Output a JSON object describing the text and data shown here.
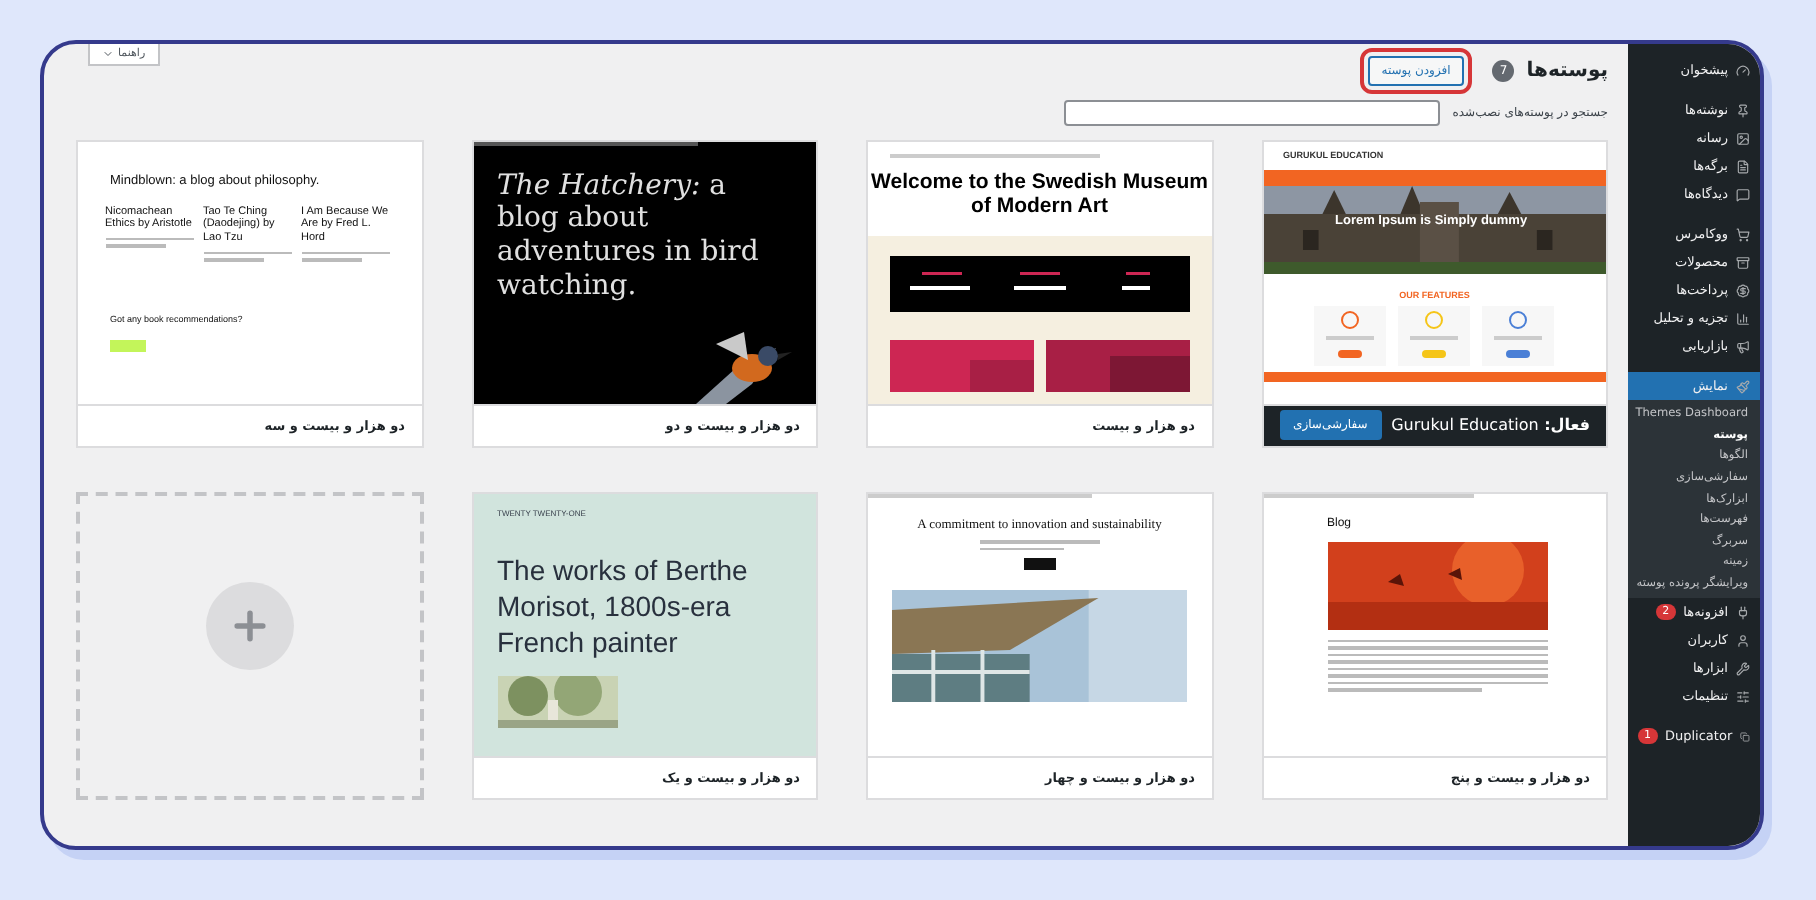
{
  "help_tab": {
    "label": "راهنما"
  },
  "header": {
    "title": "پوسته‌ها",
    "count": "7",
    "add_button": "افزودن پوسته"
  },
  "search": {
    "label": "جستجو در پوسته‌های نصب‌شده"
  },
  "themes": [
    {
      "kind": "gurukul",
      "active": true,
      "active_prefix": "فعال:",
      "name": "Gurukul Education",
      "customize_button": "سفارشی‌سازی",
      "preview": {
        "logo": "GURUKUL EDUCATION",
        "hero": "Lorem Ipsum is Simply dummy",
        "features": "OUR FEATURES"
      }
    },
    {
      "kind": "museum",
      "active": false,
      "name": "دو هزار و بیست",
      "preview": {
        "headline": "Welcome to the Swedish Museum of Modern Art"
      }
    },
    {
      "kind": "hatchery",
      "active": false,
      "name": "دو هزار و بیست و دو",
      "preview": {
        "headline": "*The Hatchery:* a blog about adventures in bird watching."
      }
    },
    {
      "kind": "mindblown",
      "active": false,
      "name": "دو هزار و بیست و سه",
      "preview": {
        "headline": "Mindblown: a blog about philosophy.",
        "posts": [
          "I Am Because We Are by Fred L. Hord",
          "Tao Te Ching (Daodejing) by Lao Tzu",
          "Nicomachean Ethics by Aristotle"
        ],
        "question": "Got any book recommendations?"
      }
    },
    {
      "kind": "blog",
      "active": false,
      "name": "دو هزار و بیست و پنج",
      "preview": {
        "headline": "Blog"
      }
    },
    {
      "kind": "commitment",
      "active": false,
      "name": "دو هزار و بیست و چهار",
      "preview": {
        "headline": "A commitment to innovation and sustainability"
      }
    },
    {
      "kind": "painter",
      "active": false,
      "name": "دو هزار و بیست و یک",
      "preview": {
        "site_title": "TWENTY TWENTY-ONE",
        "headline": "The works of Berthe Morisot, 1800s-era French painter"
      }
    },
    {
      "kind": "add_new"
    }
  ],
  "sidebar": {
    "groups": [
      {
        "items": [
          {
            "label": "پیشخوان",
            "selected": false
          }
        ]
      },
      {
        "items": [
          {
            "label": "نوشته‌ها",
            "selected": false
          },
          {
            "label": "رسانه",
            "selected": false
          },
          {
            "label": "برگه‌ها",
            "selected": false
          },
          {
            "label": "دیدگاه‌ها",
            "selected": false
          }
        ]
      },
      {
        "items": [
          {
            "label": "ووکامرس",
            "selected": false
          },
          {
            "label": "محصولات",
            "selected": false
          },
          {
            "label": "پرداخت‌ها",
            "selected": false
          },
          {
            "label": "تجزیه و تحلیل",
            "selected": false
          },
          {
            "label": "بازاریابی",
            "selected": false
          }
        ]
      },
      {
        "items": [
          {
            "label": "نمایش",
            "selected": true,
            "children": [
              {
                "label": "Themes Dashboard",
                "selected": false
              },
              {
                "label": "پوسته",
                "selected": true
              },
              {
                "label": "الگوها",
                "selected": false
              },
              {
                "label": "سفارشی‌سازی",
                "selected": false
              },
              {
                "label": "ابزارک‌ها",
                "selected": false
              },
              {
                "label": "فهرست‌ها",
                "selected": false
              },
              {
                "label": "سربرگ",
                "selected": false
              },
              {
                "label": "زمینه",
                "selected": false
              },
              {
                "label": "ویرایشگر پرونده پوسته",
                "selected": false
              }
            ]
          },
          {
            "label": "افزونه‌ها",
            "selected": false,
            "badge": "2"
          },
          {
            "label": "کاربران",
            "selected": false
          },
          {
            "label": "ابزارها",
            "selected": false
          },
          {
            "label": "تنظیمات",
            "selected": false
          }
        ]
      },
      {
        "items": [
          {
            "label": "Duplicator",
            "selected": false,
            "badge": "1"
          }
        ]
      }
    ]
  }
}
